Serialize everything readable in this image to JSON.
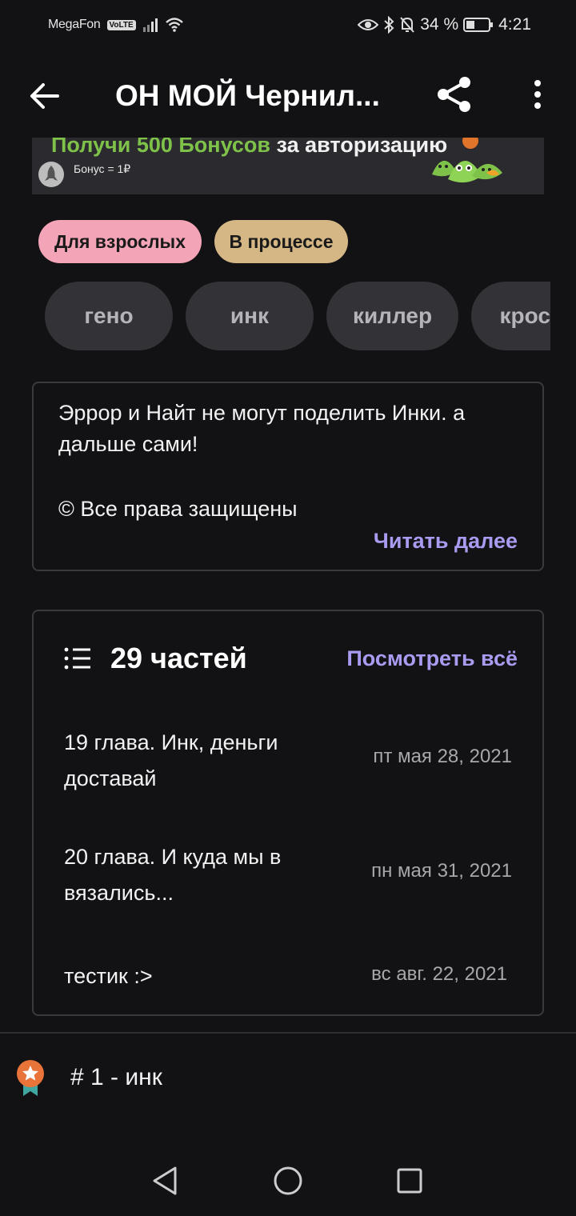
{
  "status_bar": {
    "carrier": "MegaFon",
    "volte": "VoLTE",
    "battery": "34 %",
    "time": "4:21"
  },
  "app_bar": {
    "title": "ОН МОЙ Чернил..."
  },
  "banner": {
    "text_green": "Получи 500 Бонусов",
    "text_white": " за авторизацию",
    "bonus_rate": "Бонус = 1₽"
  },
  "chips": {
    "adult": "Для взрослых",
    "status": "В процессе"
  },
  "tags": [
    "гено",
    "инк",
    "киллер",
    "кросс"
  ],
  "description": {
    "text": "Эррор и Найт не могут поделить Инки. а дальше сами!",
    "copyright": "© Все права защищены",
    "read_more": "Читать далее"
  },
  "parts": {
    "count_label": "29 частей",
    "see_all": "Посмотреть всё",
    "chapters": [
      {
        "title": "19 глава. Инк, деньги доставай",
        "date": "пт мая 28, 2021"
      },
      {
        "title": "20 глава. И куда мы в вязались...",
        "date": "пн мая 31, 2021"
      },
      {
        "title": "тестик :>",
        "date": "вс авг. 22, 2021"
      }
    ]
  },
  "ranking": {
    "text": "# 1 - инк"
  },
  "colors": {
    "background": "#121114",
    "accent": "#a99bf0",
    "chip_adult": "#f3a4b6",
    "chip_progress": "#d4b784",
    "tag_bg": "#333236"
  }
}
